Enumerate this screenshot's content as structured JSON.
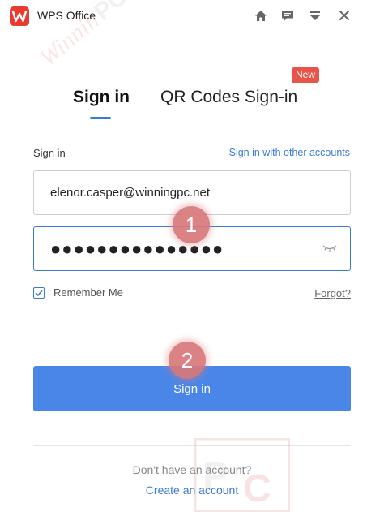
{
  "window": {
    "title": "WPS Office",
    "icons": [
      "home-icon",
      "message-icon",
      "minimize-menu-icon",
      "close-icon"
    ]
  },
  "tabs": [
    {
      "label": "Sign in",
      "active": true
    },
    {
      "label": "QR Codes Sign-in",
      "active": false,
      "badge": "New"
    }
  ],
  "form": {
    "section_label": "Sign in",
    "other_accounts_link": "Sign in with other accounts",
    "email_value": "elenor.casper@winningpc.net",
    "password_value": "●●●●●●●●●●●●●●●",
    "remember_label": "Remember Me",
    "remember_checked": true,
    "forgot_link": "Forgot?",
    "submit_label": "Sign in"
  },
  "annotations": {
    "step1": "1",
    "step2": "2"
  },
  "footer": {
    "prompt": "Don't have an account?",
    "create_link": "Create an account"
  },
  "colors": {
    "accent": "#4a86e8",
    "link": "#3a7bd5",
    "badge_red": "#e8534a",
    "step_badge": "#d9787a"
  }
}
